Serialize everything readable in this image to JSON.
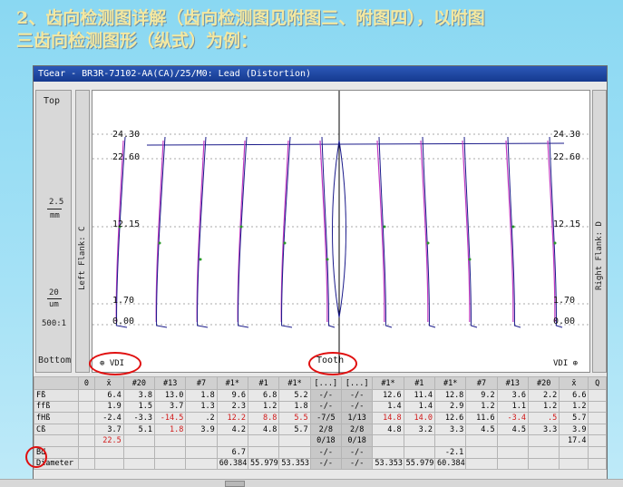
{
  "heading": {
    "line1": "2、齿向检测图详解（齿向检测图见附图三、附图四），以附图",
    "line2": "三齿向检测图形（纵式）为例："
  },
  "window": {
    "title": "TGear - BR3R-7J102-AA(CA)/25/M0: Lead (Distortion)"
  },
  "left_panel": {
    "top": "Top",
    "bottom": "Bottom",
    "scale_top": "2.5",
    "scale_bottom": "mm",
    "micron_value": "20",
    "micron_unit": "um",
    "ratio": "500:1"
  },
  "flank_labels": {
    "left": "Left Flank: C",
    "right": "Right Flank: D"
  },
  "axis": {
    "ticks_left": [
      "24.30",
      "22.60",
      "12.15",
      "1.70",
      "0.00"
    ],
    "ticks_right": [
      "24.30",
      "22.60",
      "12.15",
      "1.70",
      "0.00"
    ],
    "vdi_left": "⊕ VDI",
    "vdi_right": "VDI ⊕",
    "tooth": "Tooth"
  },
  "table": {
    "header": [
      "",
      "0",
      "x̄",
      "#20",
      "#13",
      "#7",
      "#1*",
      "#1",
      "#1*",
      "[...]",
      "[...]",
      "#1*",
      "#1",
      "#1*",
      "#7",
      "#13",
      "#20",
      "x̄",
      "Q"
    ],
    "rows": [
      {
        "label": "Fß",
        "cells": [
          "",
          "6.4",
          "3.8",
          "13.0",
          "1.8",
          "9.6",
          "6.8",
          "5.2",
          "-/-",
          "-/-",
          "12.6",
          "11.4",
          "12.8",
          "9.2",
          "3.6",
          "2.2",
          "6.6",
          ""
        ]
      },
      {
        "label": "ffß",
        "cells": [
          "",
          "1.9",
          "1.5",
          "3.7",
          "1.3",
          "2.3",
          "1.2",
          "1.8",
          "-/-",
          "-/-",
          "1.4",
          "1.4",
          "2.9",
          "1.2",
          "1.1",
          "1.2",
          "1.2",
          ""
        ]
      },
      {
        "label": "fHß",
        "cells": [
          "",
          "-2.4",
          "-3.3",
          "-14.5",
          ".2",
          "12.2",
          "8.8",
          "5.5",
          "-7/5",
          "1/13",
          "14.8",
          "14.0",
          "12.6",
          "11.6",
          "-3.4",
          ".5",
          "5.7",
          ""
        ]
      },
      {
        "label": "Cß",
        "cells": [
          "",
          "3.7",
          "5.1",
          "1.8",
          "3.9",
          "4.2",
          "4.8",
          "5.7",
          "2/8",
          "2/8",
          "4.8",
          "3.2",
          "3.3",
          "4.5",
          "4.5",
          "3.3",
          "3.9",
          ""
        ]
      },
      {
        "label": "",
        "cells": [
          "",
          "22.5",
          "",
          "",
          "",
          "",
          "",
          "",
          "0/18",
          "0/18",
          "",
          "",
          "",
          "",
          "",
          "",
          "17.4",
          ""
        ]
      },
      {
        "label": "Bd",
        "cells": [
          "",
          "",
          "",
          "",
          "",
          "6.7",
          "",
          "",
          "-/-",
          "-/-",
          "",
          "",
          "-2.1",
          "",
          "",
          "",
          "",
          ""
        ]
      },
      {
        "label": "Diameter",
        "cells": [
          "",
          "",
          "",
          "",
          "",
          "60.384",
          "55.979",
          "53.353",
          "-/-",
          "-/-",
          "53.353",
          "55.979",
          "60.384",
          "",
          "",
          "",
          "",
          ""
        ]
      }
    ]
  },
  "colors": {
    "title_bar": "#1f47a3",
    "measured_curve": "#1a1a8a",
    "tolerance_curve": "#c23bc2",
    "annotation": "#e01010",
    "heading_text": "#f4e8a0"
  }
}
